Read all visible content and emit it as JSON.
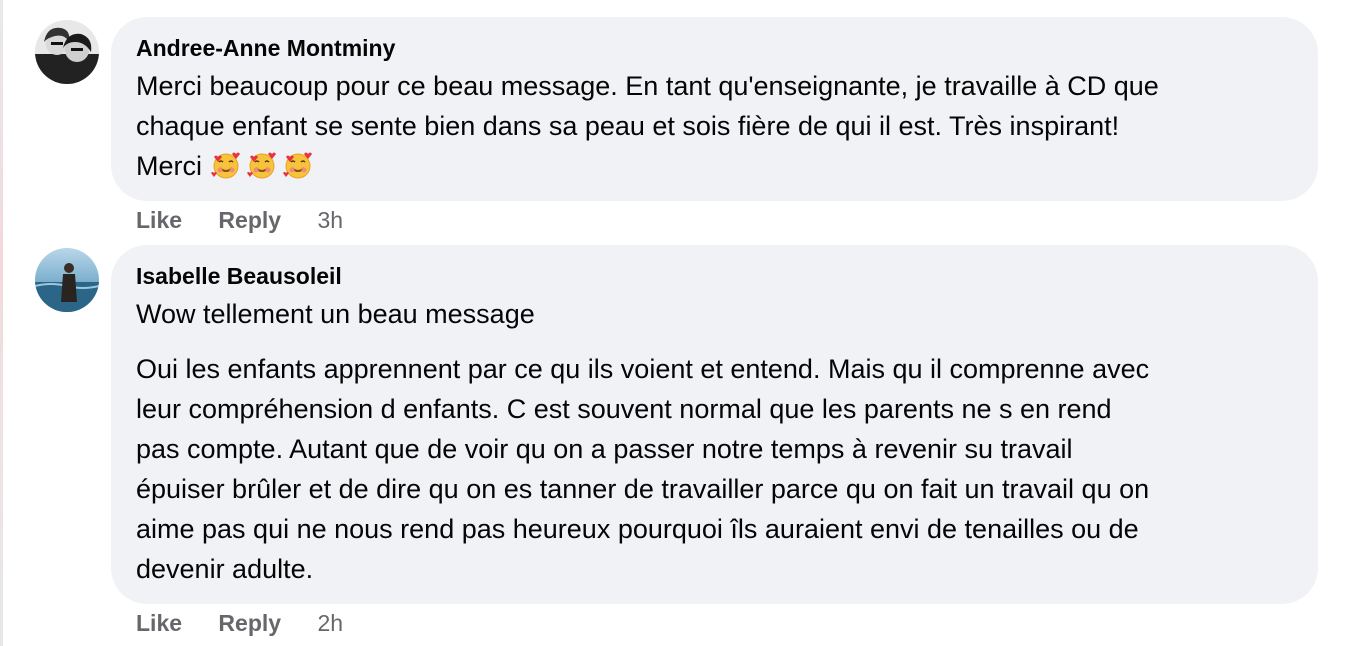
{
  "comments": [
    {
      "author": "Andree-Anne Montminy",
      "text_lines": [
        "Merci beaucoup pour ce beau message. En tant qu'enseignante, je travaille à CD que",
        "chaque enfant se sente bien dans sa peau et sois fière de qui il est. Très inspirant!"
      ],
      "last_line": "Merci",
      "emoji": "smiling-face-with-hearts-icon",
      "emoji_count": 3,
      "like_label": "Like",
      "reply_label": "Reply",
      "time": "3h"
    },
    {
      "author": "Isabelle Beausoleil",
      "para1": "Wow tellement un beau message",
      "para2_lines": [
        "Oui les enfants apprennent par ce qu ils voient et entend. Mais qu il comprenne avec",
        "leur compréhension d enfants. C est souvent normal que les parents ne s en rend",
        "pas compte. Autant que de voir qu on a passer notre temps à revenir su travail",
        "épuiser brûler et de dire qu on es tanner de travailler parce qu on fait un travail qu on",
        "aime pas qui ne nous rend pas heureux pourquoi îls auraient envi de tenailles ou de",
        "devenir adulte."
      ],
      "like_label": "Like",
      "reply_label": "Reply",
      "time": "2h"
    }
  ],
  "colors": {
    "bubble": "#f0f2f5",
    "meta_text": "#65676b",
    "text": "#050505"
  }
}
